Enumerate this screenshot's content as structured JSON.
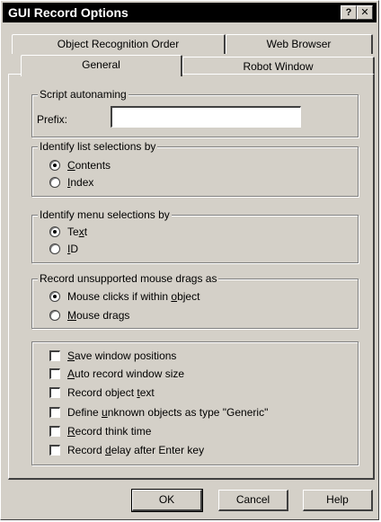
{
  "window": {
    "title": "GUI Record Options",
    "help_button": "?",
    "close_button": "✕"
  },
  "tabs": {
    "row_back": [
      "Object Recognition Order",
      "Web Browser"
    ],
    "row_front": [
      "General",
      "Robot Window"
    ],
    "active": "General"
  },
  "script_autonaming": {
    "legend": "Script autonaming",
    "prefix_label": "Prefix:",
    "prefix_value": ""
  },
  "list_selections": {
    "legend": "Identify list selections by",
    "options": [
      {
        "label_pre": "",
        "label_u": "C",
        "label_post": "ontents",
        "checked": true
      },
      {
        "label_pre": "",
        "label_u": "I",
        "label_post": "ndex",
        "checked": false
      }
    ]
  },
  "menu_selections": {
    "legend": "Identify menu selections by",
    "options": [
      {
        "label_pre": "Te",
        "label_u": "x",
        "label_post": "t",
        "checked": true
      },
      {
        "label_pre": "",
        "label_u": "I",
        "label_post": "D",
        "checked": false
      }
    ]
  },
  "mouse_drags": {
    "legend": "Record unsupported mouse drags as",
    "options": [
      {
        "label_pre": "Mouse clicks if within ",
        "label_u": "o",
        "label_post": "bject",
        "checked": true
      },
      {
        "label_pre": "",
        "label_u": "M",
        "label_post": "ouse drags",
        "checked": false
      }
    ]
  },
  "checkboxes": [
    {
      "label_pre": "",
      "label_u": "S",
      "label_post": "ave window positions",
      "checked": false
    },
    {
      "label_pre": "",
      "label_u": "A",
      "label_post": "uto record window size",
      "checked": false
    },
    {
      "label_pre": "Record object ",
      "label_u": "t",
      "label_post": "ext",
      "checked": false
    },
    {
      "label_pre": "Define ",
      "label_u": "u",
      "label_post": "nknown objects as type \"Generic\"",
      "checked": false
    },
    {
      "label_pre": "",
      "label_u": "R",
      "label_post": "ecord think time",
      "checked": false
    },
    {
      "label_pre": "Record ",
      "label_u": "d",
      "label_post": "elay after Enter key",
      "checked": false
    }
  ],
  "buttons": {
    "ok": "OK",
    "cancel": "Cancel",
    "help": "Help"
  }
}
